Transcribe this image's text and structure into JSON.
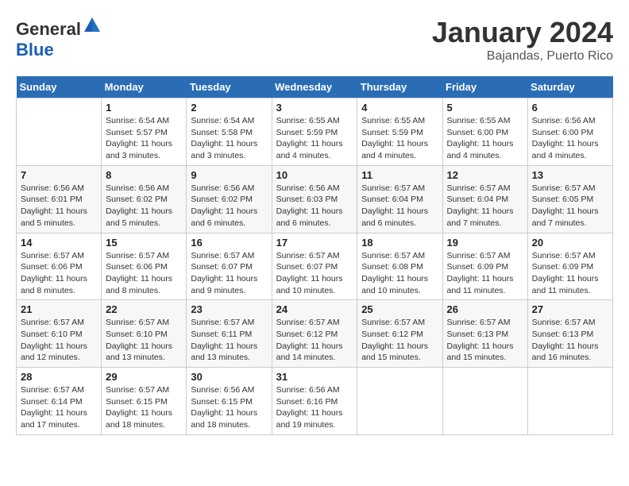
{
  "header": {
    "logo_general": "General",
    "logo_blue": "Blue",
    "month": "January 2024",
    "location": "Bajandas, Puerto Rico"
  },
  "calendar": {
    "weekdays": [
      "Sunday",
      "Monday",
      "Tuesday",
      "Wednesday",
      "Thursday",
      "Friday",
      "Saturday"
    ],
    "rows": [
      [
        {
          "day": "",
          "sunrise": "",
          "sunset": "",
          "daylight": ""
        },
        {
          "day": "1",
          "sunrise": "Sunrise: 6:54 AM",
          "sunset": "Sunset: 5:57 PM",
          "daylight": "Daylight: 11 hours and 3 minutes."
        },
        {
          "day": "2",
          "sunrise": "Sunrise: 6:54 AM",
          "sunset": "Sunset: 5:58 PM",
          "daylight": "Daylight: 11 hours and 3 minutes."
        },
        {
          "day": "3",
          "sunrise": "Sunrise: 6:55 AM",
          "sunset": "Sunset: 5:59 PM",
          "daylight": "Daylight: 11 hours and 4 minutes."
        },
        {
          "day": "4",
          "sunrise": "Sunrise: 6:55 AM",
          "sunset": "Sunset: 5:59 PM",
          "daylight": "Daylight: 11 hours and 4 minutes."
        },
        {
          "day": "5",
          "sunrise": "Sunrise: 6:55 AM",
          "sunset": "Sunset: 6:00 PM",
          "daylight": "Daylight: 11 hours and 4 minutes."
        },
        {
          "day": "6",
          "sunrise": "Sunrise: 6:56 AM",
          "sunset": "Sunset: 6:00 PM",
          "daylight": "Daylight: 11 hours and 4 minutes."
        }
      ],
      [
        {
          "day": "7",
          "sunrise": "Sunrise: 6:56 AM",
          "sunset": "Sunset: 6:01 PM",
          "daylight": "Daylight: 11 hours and 5 minutes."
        },
        {
          "day": "8",
          "sunrise": "Sunrise: 6:56 AM",
          "sunset": "Sunset: 6:02 PM",
          "daylight": "Daylight: 11 hours and 5 minutes."
        },
        {
          "day": "9",
          "sunrise": "Sunrise: 6:56 AM",
          "sunset": "Sunset: 6:02 PM",
          "daylight": "Daylight: 11 hours and 6 minutes."
        },
        {
          "day": "10",
          "sunrise": "Sunrise: 6:56 AM",
          "sunset": "Sunset: 6:03 PM",
          "daylight": "Daylight: 11 hours and 6 minutes."
        },
        {
          "day": "11",
          "sunrise": "Sunrise: 6:57 AM",
          "sunset": "Sunset: 6:04 PM",
          "daylight": "Daylight: 11 hours and 6 minutes."
        },
        {
          "day": "12",
          "sunrise": "Sunrise: 6:57 AM",
          "sunset": "Sunset: 6:04 PM",
          "daylight": "Daylight: 11 hours and 7 minutes."
        },
        {
          "day": "13",
          "sunrise": "Sunrise: 6:57 AM",
          "sunset": "Sunset: 6:05 PM",
          "daylight": "Daylight: 11 hours and 7 minutes."
        }
      ],
      [
        {
          "day": "14",
          "sunrise": "Sunrise: 6:57 AM",
          "sunset": "Sunset: 6:06 PM",
          "daylight": "Daylight: 11 hours and 8 minutes."
        },
        {
          "day": "15",
          "sunrise": "Sunrise: 6:57 AM",
          "sunset": "Sunset: 6:06 PM",
          "daylight": "Daylight: 11 hours and 8 minutes."
        },
        {
          "day": "16",
          "sunrise": "Sunrise: 6:57 AM",
          "sunset": "Sunset: 6:07 PM",
          "daylight": "Daylight: 11 hours and 9 minutes."
        },
        {
          "day": "17",
          "sunrise": "Sunrise: 6:57 AM",
          "sunset": "Sunset: 6:07 PM",
          "daylight": "Daylight: 11 hours and 10 minutes."
        },
        {
          "day": "18",
          "sunrise": "Sunrise: 6:57 AM",
          "sunset": "Sunset: 6:08 PM",
          "daylight": "Daylight: 11 hours and 10 minutes."
        },
        {
          "day": "19",
          "sunrise": "Sunrise: 6:57 AM",
          "sunset": "Sunset: 6:09 PM",
          "daylight": "Daylight: 11 hours and 11 minutes."
        },
        {
          "day": "20",
          "sunrise": "Sunrise: 6:57 AM",
          "sunset": "Sunset: 6:09 PM",
          "daylight": "Daylight: 11 hours and 11 minutes."
        }
      ],
      [
        {
          "day": "21",
          "sunrise": "Sunrise: 6:57 AM",
          "sunset": "Sunset: 6:10 PM",
          "daylight": "Daylight: 11 hours and 12 minutes."
        },
        {
          "day": "22",
          "sunrise": "Sunrise: 6:57 AM",
          "sunset": "Sunset: 6:10 PM",
          "daylight": "Daylight: 11 hours and 13 minutes."
        },
        {
          "day": "23",
          "sunrise": "Sunrise: 6:57 AM",
          "sunset": "Sunset: 6:11 PM",
          "daylight": "Daylight: 11 hours and 13 minutes."
        },
        {
          "day": "24",
          "sunrise": "Sunrise: 6:57 AM",
          "sunset": "Sunset: 6:12 PM",
          "daylight": "Daylight: 11 hours and 14 minutes."
        },
        {
          "day": "25",
          "sunrise": "Sunrise: 6:57 AM",
          "sunset": "Sunset: 6:12 PM",
          "daylight": "Daylight: 11 hours and 15 minutes."
        },
        {
          "day": "26",
          "sunrise": "Sunrise: 6:57 AM",
          "sunset": "Sunset: 6:13 PM",
          "daylight": "Daylight: 11 hours and 15 minutes."
        },
        {
          "day": "27",
          "sunrise": "Sunrise: 6:57 AM",
          "sunset": "Sunset: 6:13 PM",
          "daylight": "Daylight: 11 hours and 16 minutes."
        }
      ],
      [
        {
          "day": "28",
          "sunrise": "Sunrise: 6:57 AM",
          "sunset": "Sunset: 6:14 PM",
          "daylight": "Daylight: 11 hours and 17 minutes."
        },
        {
          "day": "29",
          "sunrise": "Sunrise: 6:57 AM",
          "sunset": "Sunset: 6:15 PM",
          "daylight": "Daylight: 11 hours and 18 minutes."
        },
        {
          "day": "30",
          "sunrise": "Sunrise: 6:56 AM",
          "sunset": "Sunset: 6:15 PM",
          "daylight": "Daylight: 11 hours and 18 minutes."
        },
        {
          "day": "31",
          "sunrise": "Sunrise: 6:56 AM",
          "sunset": "Sunset: 6:16 PM",
          "daylight": "Daylight: 11 hours and 19 minutes."
        },
        {
          "day": "",
          "sunrise": "",
          "sunset": "",
          "daylight": ""
        },
        {
          "day": "",
          "sunrise": "",
          "sunset": "",
          "daylight": ""
        },
        {
          "day": "",
          "sunrise": "",
          "sunset": "",
          "daylight": ""
        }
      ]
    ]
  }
}
